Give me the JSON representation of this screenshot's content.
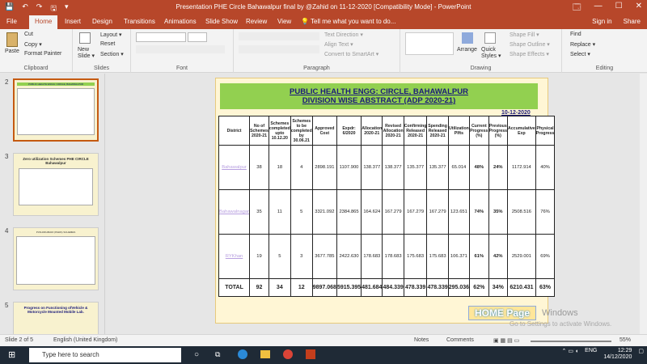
{
  "window": {
    "title": "Presentation PHE Circle Bahawalpur final by @Zahid on 11-12-2020 [Compatibility Mode] - PowerPoint",
    "qat": [
      "💾",
      "↶",
      "↷",
      "🖫",
      "▾"
    ],
    "controls": [
      "🗔",
      "—",
      "☐",
      "✕"
    ]
  },
  "tabs": [
    "File",
    "Home",
    "Insert",
    "Design",
    "Transitions",
    "Animations",
    "Slide Show",
    "Review",
    "View",
    "💡 Tell me what you want to do..."
  ],
  "tabs_right": {
    "signin": "Sign in",
    "share": "Share"
  },
  "ribbon": {
    "clipboard": {
      "paste": "Paste",
      "cut": "Cut",
      "copy": "Copy ▾",
      "format_painter": "Format Painter",
      "label": "Clipboard"
    },
    "slides": {
      "new_slide": "New Slide ▾",
      "layout": "Layout ▾",
      "reset": "Reset",
      "section": "Section ▾",
      "label": "Slides"
    },
    "font": {
      "label": "Font"
    },
    "paragraph": {
      "text_direction": "Text Direction ▾",
      "align_text": "Align Text ▾",
      "convert_smartart": "Convert to SmartArt ▾",
      "label": "Paragraph"
    },
    "drawing": {
      "arrange": "Arrange",
      "quick_styles": "Quick Styles ▾",
      "shape_fill": "Shape Fill ▾",
      "shape_outline": "Shape Outline ▾",
      "shape_effects": "Shape Effects ▾",
      "label": "Drawing"
    },
    "editing": {
      "find": "Find",
      "replace": "Replace ▾",
      "select": "Select ▾",
      "label": "Editing"
    }
  },
  "thumbnails": [
    {
      "num": "2",
      "title": "PUBLIC HEALTH ENGG: CIRCLE, BAHAWALPUR"
    },
    {
      "num": "3",
      "title": "Zero utilization Schemes PHE CIRCLE Bahawalpur"
    },
    {
      "num": "4",
      "title": "PUNJAB ABADI (PAWA) SCHEMES"
    },
    {
      "num": "5",
      "title": "Progress on Functioning ofVehicle & Motorcycle Mounted Mobile Lab."
    }
  ],
  "slide": {
    "title_line1": "PUBLIC HEALTH ENGG: CIRCLE, BAHAWALPUR",
    "title_line2": "DIVISION WISE ABSTRACT (ADP 2020-21)",
    "date": "10-12-2020",
    "headers": [
      "District",
      "No of Schemes 2020-21",
      "Schemes completed upto 10.12.20",
      "Schemes to be completed by 30.06.21",
      "Approved Cost",
      "Expdr: 6/2020",
      "Allocation 2020-21",
      "Revised Allocation 2020-21",
      "Confirming Released 2020-21",
      "Spending Released 2020-21",
      "Utilization Plfts",
      "Current Progress (%)",
      "Previous Progress (%)",
      "Accumulative Exp",
      "Physical Progress"
    ],
    "rows": [
      [
        "Bahawalpur",
        "38",
        "18",
        "4",
        "2898.191",
        "1107.900",
        "138.377",
        "138.377",
        "135.377",
        "135.377",
        "65.014",
        "48%",
        "24%",
        "1172.914",
        "40%"
      ],
      [
        "Bahawalnagar",
        "35",
        "11",
        "5",
        "3321.092",
        "2384.865",
        "164.624",
        "167.279",
        "167.279",
        "167.279",
        "123.651",
        "74%",
        "35%",
        "2508.516",
        "76%"
      ],
      [
        "RYKhan",
        "19",
        "5",
        "3",
        "3677.785",
        "2422.630",
        "178.683",
        "178.683",
        "175.683",
        "175.683",
        "106.371",
        "61%",
        "42%",
        "2529.001",
        "69%"
      ]
    ],
    "total": [
      "TOTAL",
      "92",
      "34",
      "12",
      "9897.068",
      "5915.395",
      "481.684",
      "484.339",
      "478.339",
      "478.339",
      "295.036",
      "62%",
      "34%",
      "6210.431",
      "63%"
    ],
    "home_button": "HOME Page"
  },
  "watermark": {
    "line1": "Windows",
    "line2": "Go to Settings to activate Windows."
  },
  "status": {
    "slide": "Slide 2 of 5",
    "language": "English (United Kingdom)",
    "notes": "Notes",
    "comments": "Comments",
    "zoom": "55%"
  },
  "taskbar": {
    "search": "Type here to search",
    "lang": "ENG",
    "time": "12:29",
    "date": "14/12/2020"
  },
  "colors": {
    "accent": "#b7472a",
    "header_green": "#92d050",
    "slide_bg": "#fff6d5"
  }
}
